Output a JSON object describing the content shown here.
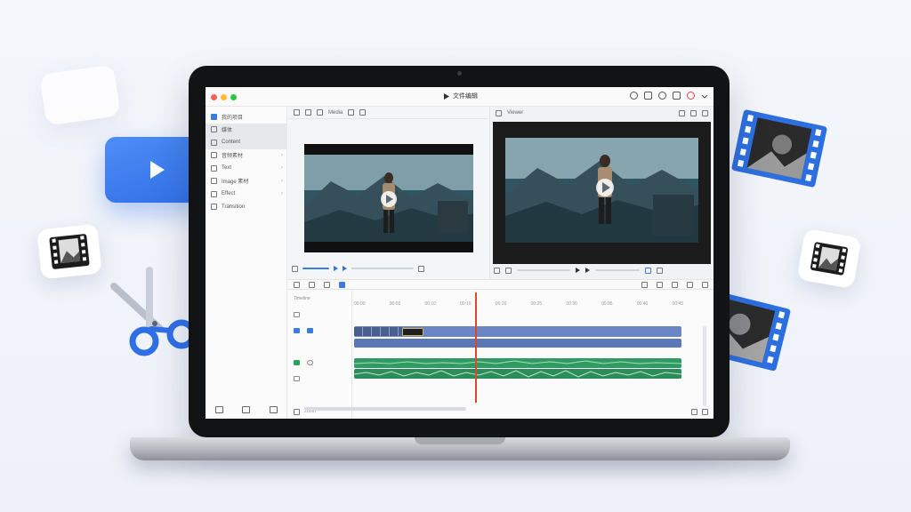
{
  "app": {
    "window_title": "文件编辑",
    "title_icons": [
      "search-icon",
      "mic-icon",
      "chat-icon",
      "record-icon",
      "chevron-down-icon"
    ]
  },
  "sidebar": {
    "items": [
      {
        "label": "我的项目",
        "icon": "folder-icon",
        "selected": false
      },
      {
        "label": "媒体",
        "icon": "media-icon",
        "selected": true
      },
      {
        "label": "Content",
        "icon": "content-icon",
        "selected": true
      },
      {
        "label": "音频素材",
        "icon": "audio-icon",
        "chevron": "›"
      },
      {
        "label": "Text",
        "icon": "text-icon",
        "chevron": "›"
      },
      {
        "label": "Image 素材",
        "icon": "image-icon",
        "chevron": "›"
      },
      {
        "label": "Effect",
        "icon": "effect-icon",
        "chevron": "›"
      },
      {
        "label": "Transition",
        "icon": "transition-icon"
      }
    ],
    "bottom_icons": [
      "crop-icon",
      "layout-icon",
      "share-icon"
    ]
  },
  "media_pane": {
    "toolbar_label": "Media"
  },
  "viewer_pane": {
    "toolbar_label": "Viewer"
  },
  "timeline": {
    "label": "Timeline",
    "ruler_ticks": [
      "00:00",
      "00:05",
      "00:10",
      "00:15",
      "00:20",
      "00:25",
      "00:30",
      "00:35",
      "00:40",
      "00:45"
    ],
    "footer_label": "Zoom"
  },
  "colors": {
    "accent": "#2f6fe6",
    "video_track": "#6b86c4",
    "audio_track": "#2f9b63",
    "playhead": "#e0452e"
  }
}
